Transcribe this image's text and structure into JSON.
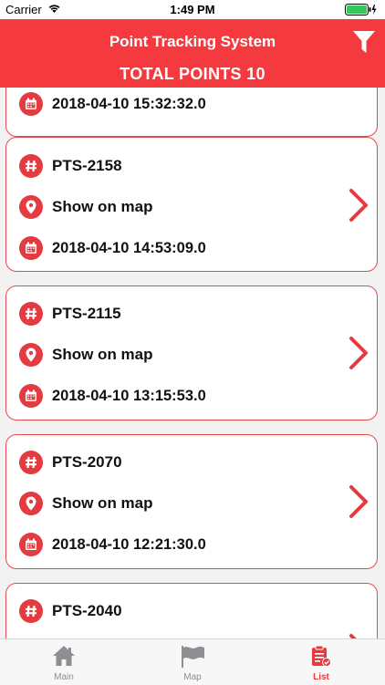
{
  "status_bar": {
    "carrier": "Carrier",
    "time": "1:49 PM"
  },
  "header": {
    "title": "Point Tracking System",
    "subtitle": "TOTAL POINTS 10"
  },
  "top_partial_card": {
    "date": "2018-04-10 15:32:32.0"
  },
  "cards": [
    {
      "id": "PTS-2158",
      "map_label": "Show on map",
      "date": "2018-04-10 14:53:09.0"
    },
    {
      "id": "PTS-2115",
      "map_label": "Show on map",
      "date": "2018-04-10 13:15:53.0"
    },
    {
      "id": "PTS-2070",
      "map_label": "Show on map",
      "date": "2018-04-10 12:21:30.0"
    },
    {
      "id": "PTS-2040"
    }
  ],
  "tabbar": {
    "tabs": [
      {
        "label": "Main",
        "icon": "home-icon"
      },
      {
        "label": "Map",
        "icon": "flag-icon"
      },
      {
        "label": "List",
        "icon": "clipboard-check-icon",
        "active": true
      }
    ]
  },
  "colors": {
    "accent": "#f53a3f",
    "icon_bg": "#e43b41",
    "inactive_tab": "#8e8e93"
  }
}
